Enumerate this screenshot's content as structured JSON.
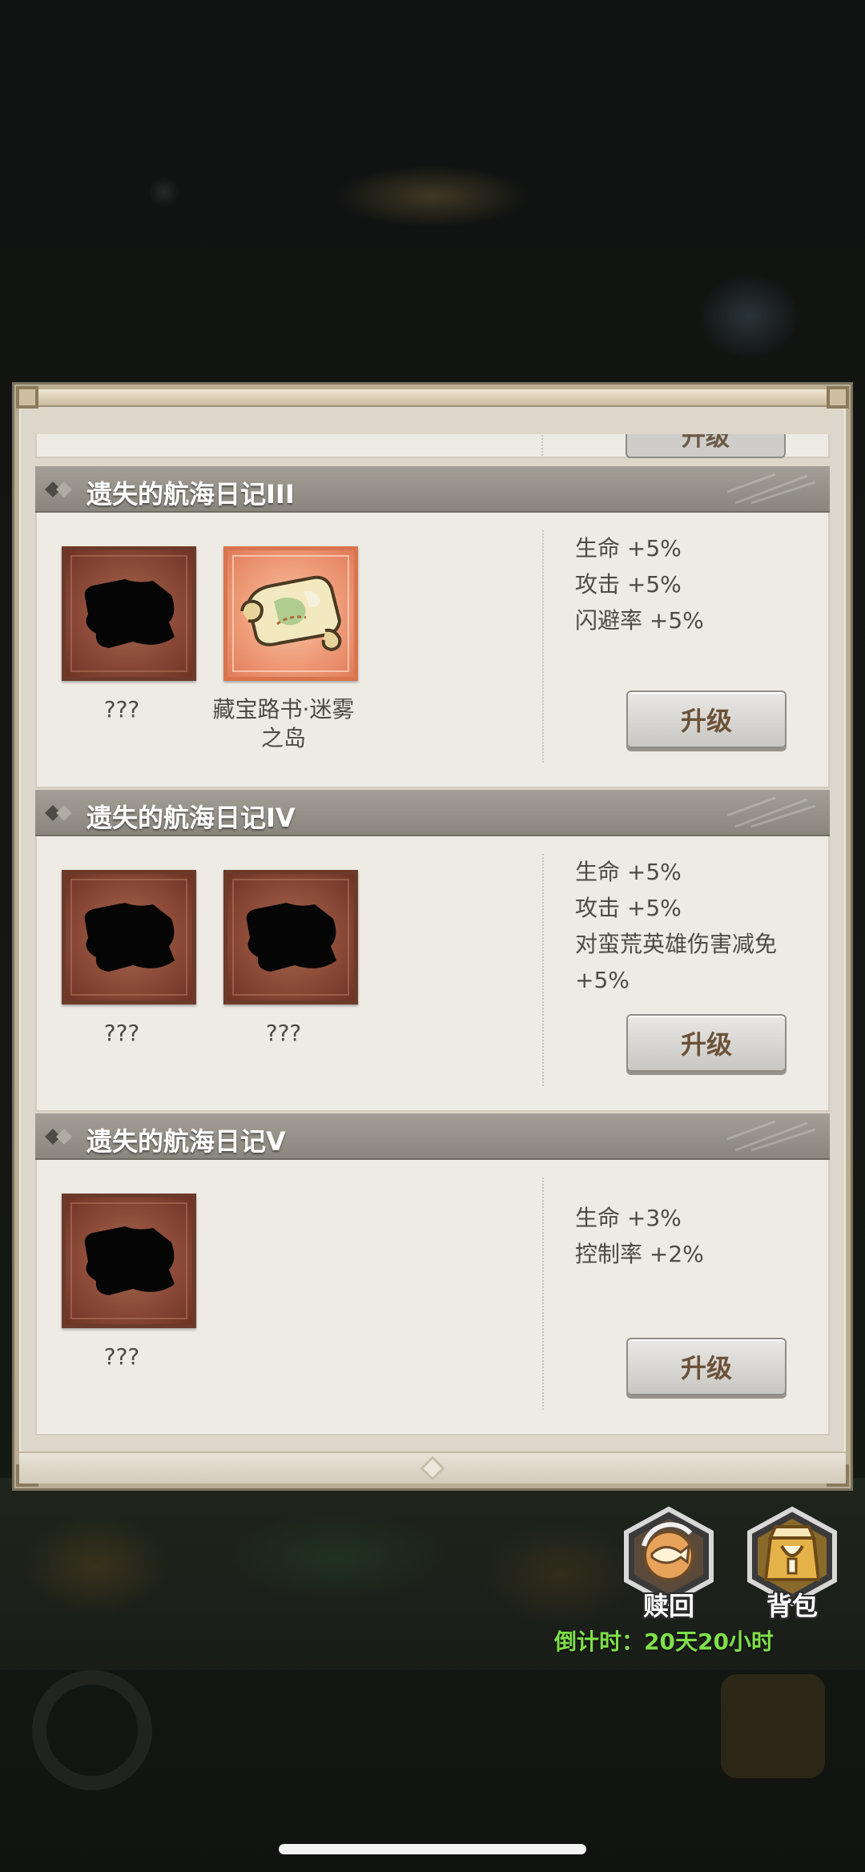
{
  "partial_card": {
    "button_label": "升级"
  },
  "sections": [
    {
      "title": "遗失的航海日记III",
      "items": [
        {
          "name": "???",
          "state": "locked",
          "icon": "scroll-silhouette-icon"
        },
        {
          "name": "藏宝路书·迷雾之岛",
          "state": "unlocked",
          "icon": "treasure-map-icon"
        }
      ],
      "stats": [
        "生命 +5%",
        "攻击 +5%",
        "闪避率 +5%"
      ],
      "button_label": "升级"
    },
    {
      "title": "遗失的航海日记IV",
      "items": [
        {
          "name": "???",
          "state": "locked",
          "icon": "scroll-silhouette-icon"
        },
        {
          "name": "???",
          "state": "locked",
          "icon": "scroll-silhouette-icon"
        }
      ],
      "stats": [
        "生命 +5%",
        "攻击 +5%",
        "对蛮荒英雄伤害减免",
        "+5%"
      ],
      "button_label": "升级"
    },
    {
      "title": "遗失的航海日记V",
      "items": [
        {
          "name": "???",
          "state": "locked",
          "icon": "scroll-silhouette-icon"
        }
      ],
      "stats": [
        "生命 +3%",
        "控制率 +2%"
      ],
      "button_label": "升级"
    }
  ],
  "actions": {
    "redeem_label": "赎回",
    "backpack_label": "背包"
  },
  "countdown": "倒计时：20天20小时",
  "colors": {
    "header_bg": "#8a867d",
    "card_bg": "#eeebe5",
    "locked_item": "#8b4a37",
    "unlocked_item": "#ef9c78",
    "countdown_green": "#7fe04a"
  }
}
